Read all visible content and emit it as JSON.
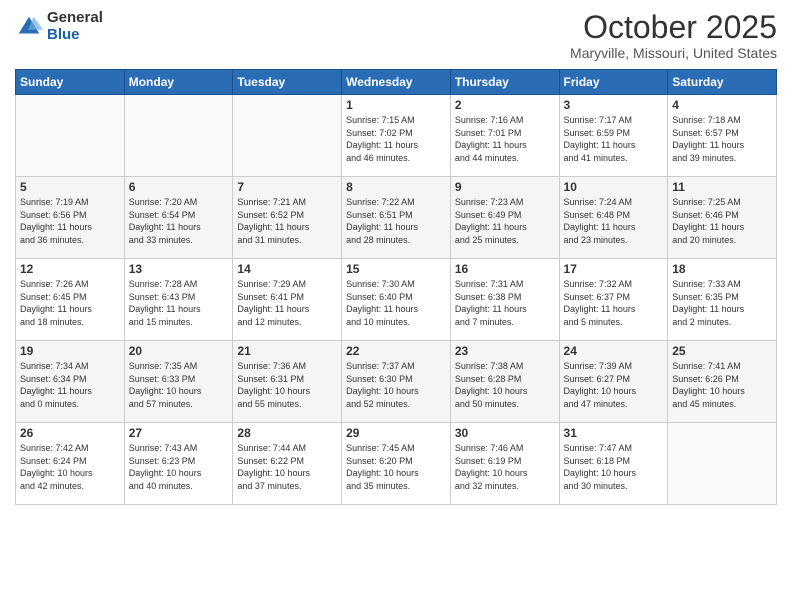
{
  "logo": {
    "general": "General",
    "blue": "Blue"
  },
  "header": {
    "title": "October 2025",
    "location": "Maryville, Missouri, United States"
  },
  "days": [
    "Sunday",
    "Monday",
    "Tuesday",
    "Wednesday",
    "Thursday",
    "Friday",
    "Saturday"
  ],
  "weeks": [
    [
      {
        "num": "",
        "info": ""
      },
      {
        "num": "",
        "info": ""
      },
      {
        "num": "",
        "info": ""
      },
      {
        "num": "1",
        "info": "Sunrise: 7:15 AM\nSunset: 7:02 PM\nDaylight: 11 hours\nand 46 minutes."
      },
      {
        "num": "2",
        "info": "Sunrise: 7:16 AM\nSunset: 7:01 PM\nDaylight: 11 hours\nand 44 minutes."
      },
      {
        "num": "3",
        "info": "Sunrise: 7:17 AM\nSunset: 6:59 PM\nDaylight: 11 hours\nand 41 minutes."
      },
      {
        "num": "4",
        "info": "Sunrise: 7:18 AM\nSunset: 6:57 PM\nDaylight: 11 hours\nand 39 minutes."
      }
    ],
    [
      {
        "num": "5",
        "info": "Sunrise: 7:19 AM\nSunset: 6:56 PM\nDaylight: 11 hours\nand 36 minutes."
      },
      {
        "num": "6",
        "info": "Sunrise: 7:20 AM\nSunset: 6:54 PM\nDaylight: 11 hours\nand 33 minutes."
      },
      {
        "num": "7",
        "info": "Sunrise: 7:21 AM\nSunset: 6:52 PM\nDaylight: 11 hours\nand 31 minutes."
      },
      {
        "num": "8",
        "info": "Sunrise: 7:22 AM\nSunset: 6:51 PM\nDaylight: 11 hours\nand 28 minutes."
      },
      {
        "num": "9",
        "info": "Sunrise: 7:23 AM\nSunset: 6:49 PM\nDaylight: 11 hours\nand 25 minutes."
      },
      {
        "num": "10",
        "info": "Sunrise: 7:24 AM\nSunset: 6:48 PM\nDaylight: 11 hours\nand 23 minutes."
      },
      {
        "num": "11",
        "info": "Sunrise: 7:25 AM\nSunset: 6:46 PM\nDaylight: 11 hours\nand 20 minutes."
      }
    ],
    [
      {
        "num": "12",
        "info": "Sunrise: 7:26 AM\nSunset: 6:45 PM\nDaylight: 11 hours\nand 18 minutes."
      },
      {
        "num": "13",
        "info": "Sunrise: 7:28 AM\nSunset: 6:43 PM\nDaylight: 11 hours\nand 15 minutes."
      },
      {
        "num": "14",
        "info": "Sunrise: 7:29 AM\nSunset: 6:41 PM\nDaylight: 11 hours\nand 12 minutes."
      },
      {
        "num": "15",
        "info": "Sunrise: 7:30 AM\nSunset: 6:40 PM\nDaylight: 11 hours\nand 10 minutes."
      },
      {
        "num": "16",
        "info": "Sunrise: 7:31 AM\nSunset: 6:38 PM\nDaylight: 11 hours\nand 7 minutes."
      },
      {
        "num": "17",
        "info": "Sunrise: 7:32 AM\nSunset: 6:37 PM\nDaylight: 11 hours\nand 5 minutes."
      },
      {
        "num": "18",
        "info": "Sunrise: 7:33 AM\nSunset: 6:35 PM\nDaylight: 11 hours\nand 2 minutes."
      }
    ],
    [
      {
        "num": "19",
        "info": "Sunrise: 7:34 AM\nSunset: 6:34 PM\nDaylight: 11 hours\nand 0 minutes."
      },
      {
        "num": "20",
        "info": "Sunrise: 7:35 AM\nSunset: 6:33 PM\nDaylight: 10 hours\nand 57 minutes."
      },
      {
        "num": "21",
        "info": "Sunrise: 7:36 AM\nSunset: 6:31 PM\nDaylight: 10 hours\nand 55 minutes."
      },
      {
        "num": "22",
        "info": "Sunrise: 7:37 AM\nSunset: 6:30 PM\nDaylight: 10 hours\nand 52 minutes."
      },
      {
        "num": "23",
        "info": "Sunrise: 7:38 AM\nSunset: 6:28 PM\nDaylight: 10 hours\nand 50 minutes."
      },
      {
        "num": "24",
        "info": "Sunrise: 7:39 AM\nSunset: 6:27 PM\nDaylight: 10 hours\nand 47 minutes."
      },
      {
        "num": "25",
        "info": "Sunrise: 7:41 AM\nSunset: 6:26 PM\nDaylight: 10 hours\nand 45 minutes."
      }
    ],
    [
      {
        "num": "26",
        "info": "Sunrise: 7:42 AM\nSunset: 6:24 PM\nDaylight: 10 hours\nand 42 minutes."
      },
      {
        "num": "27",
        "info": "Sunrise: 7:43 AM\nSunset: 6:23 PM\nDaylight: 10 hours\nand 40 minutes."
      },
      {
        "num": "28",
        "info": "Sunrise: 7:44 AM\nSunset: 6:22 PM\nDaylight: 10 hours\nand 37 minutes."
      },
      {
        "num": "29",
        "info": "Sunrise: 7:45 AM\nSunset: 6:20 PM\nDaylight: 10 hours\nand 35 minutes."
      },
      {
        "num": "30",
        "info": "Sunrise: 7:46 AM\nSunset: 6:19 PM\nDaylight: 10 hours\nand 32 minutes."
      },
      {
        "num": "31",
        "info": "Sunrise: 7:47 AM\nSunset: 6:18 PM\nDaylight: 10 hours\nand 30 minutes."
      },
      {
        "num": "",
        "info": ""
      }
    ]
  ]
}
